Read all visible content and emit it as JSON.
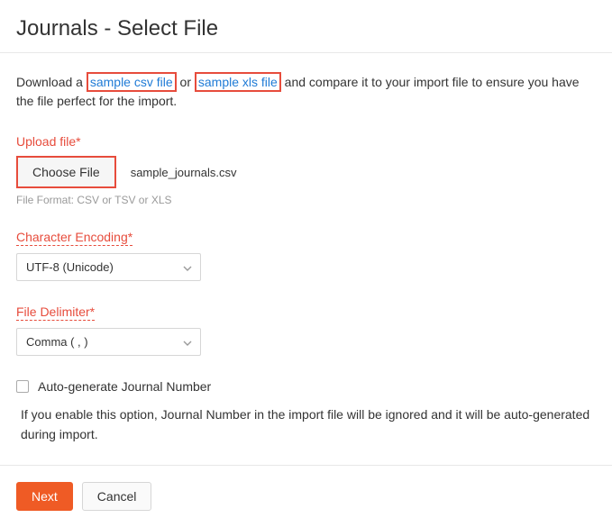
{
  "pageTitle": "Journals - Select File",
  "intro": {
    "prefix": "Download a ",
    "link1": "sample csv file",
    "mid": " or ",
    "link2": "sample xls file",
    "suffix": " and compare it to your import file to ensure you have the file perfect for the import."
  },
  "upload": {
    "label": "Upload file*",
    "button": "Choose File",
    "filename": "sample_journals.csv",
    "hint": "File Format: CSV or TSV or XLS"
  },
  "encoding": {
    "label": "Character Encoding*",
    "value": "UTF-8 (Unicode)"
  },
  "delimiter": {
    "label": "File Delimiter*",
    "value": "Comma ( , )"
  },
  "autogen": {
    "label": "Auto-generate Journal Number",
    "helper": "If you enable this option, Journal Number in the import file will be ignored and it will be auto-generated during import."
  },
  "footer": {
    "next": "Next",
    "cancel": "Cancel"
  }
}
